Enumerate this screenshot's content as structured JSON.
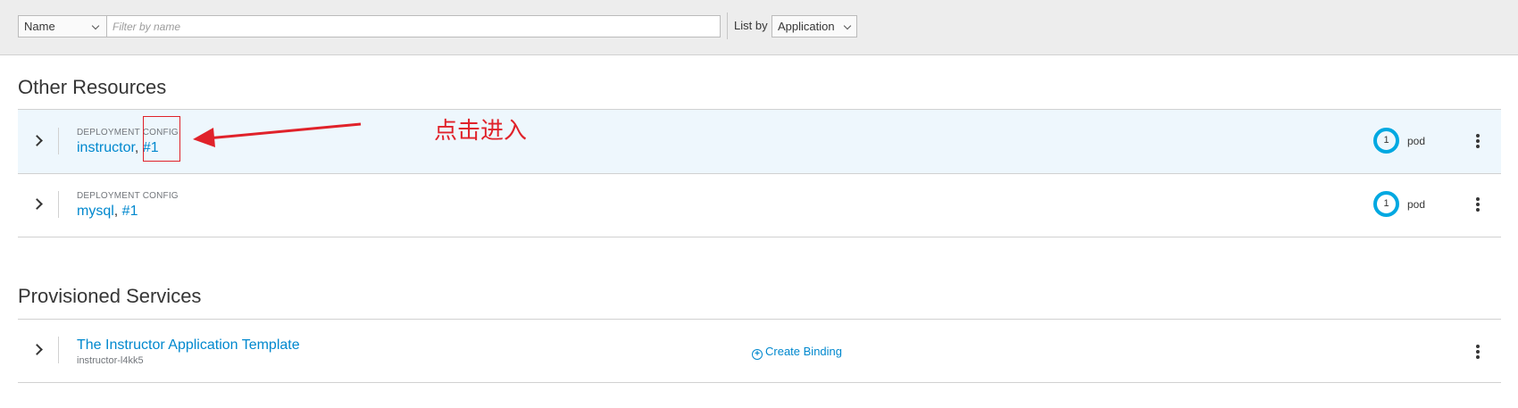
{
  "toolbar": {
    "filter_type": "Name",
    "filter_placeholder": "Filter by name",
    "list_by_label": "List by",
    "list_by_value": "Application"
  },
  "other_resources": {
    "title": "Other Resources",
    "items": [
      {
        "kind": "DEPLOYMENT CONFIG",
        "name": "instructor",
        "separator": ", ",
        "revision": "#1",
        "pod_count": "1",
        "pod_label": "pod"
      },
      {
        "kind": "DEPLOYMENT CONFIG",
        "name": "mysql",
        "separator": ", ",
        "revision": "#1",
        "pod_count": "1",
        "pod_label": "pod"
      }
    ]
  },
  "provisioned_services": {
    "title": "Provisioned Services",
    "items": [
      {
        "name": "The Instructor Application Template",
        "id": "instructor-l4kk5",
        "action": "Create Binding"
      }
    ]
  },
  "annotation": {
    "text": "点击进入",
    "color": "#e0222a"
  },
  "colors": {
    "link": "#0088ce",
    "donut": "#00a8e1",
    "selected_row": "#eef7fd"
  }
}
